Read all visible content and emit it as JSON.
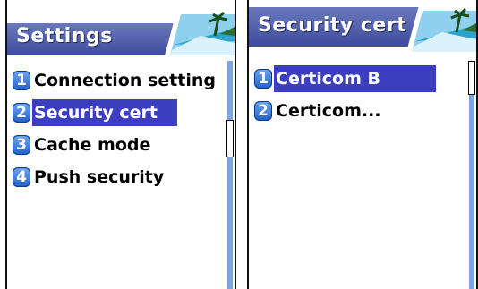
{
  "left_screen": {
    "title": "Settings",
    "items": [
      {
        "number": "1",
        "label": "Connection setting"
      },
      {
        "number": "2",
        "label": "Security cert"
      },
      {
        "number": "3",
        "label": "Cache mode"
      },
      {
        "number": "4",
        "label": "Push security"
      }
    ],
    "selected_index": 1
  },
  "right_screen": {
    "title": "Security cert",
    "items": [
      {
        "number": "1",
        "label": "Certicom B"
      },
      {
        "number": "2",
        "label": "Certicom..."
      }
    ],
    "selected_index": 0
  },
  "colors": {
    "title_band": "#3e4d9c",
    "selection": "#3b3fbf",
    "badge": "#1f5fc9",
    "scrollbar": "#7aa6e8"
  },
  "icons": [
    "beach-landscape-icon",
    "number-badge-icon"
  ]
}
